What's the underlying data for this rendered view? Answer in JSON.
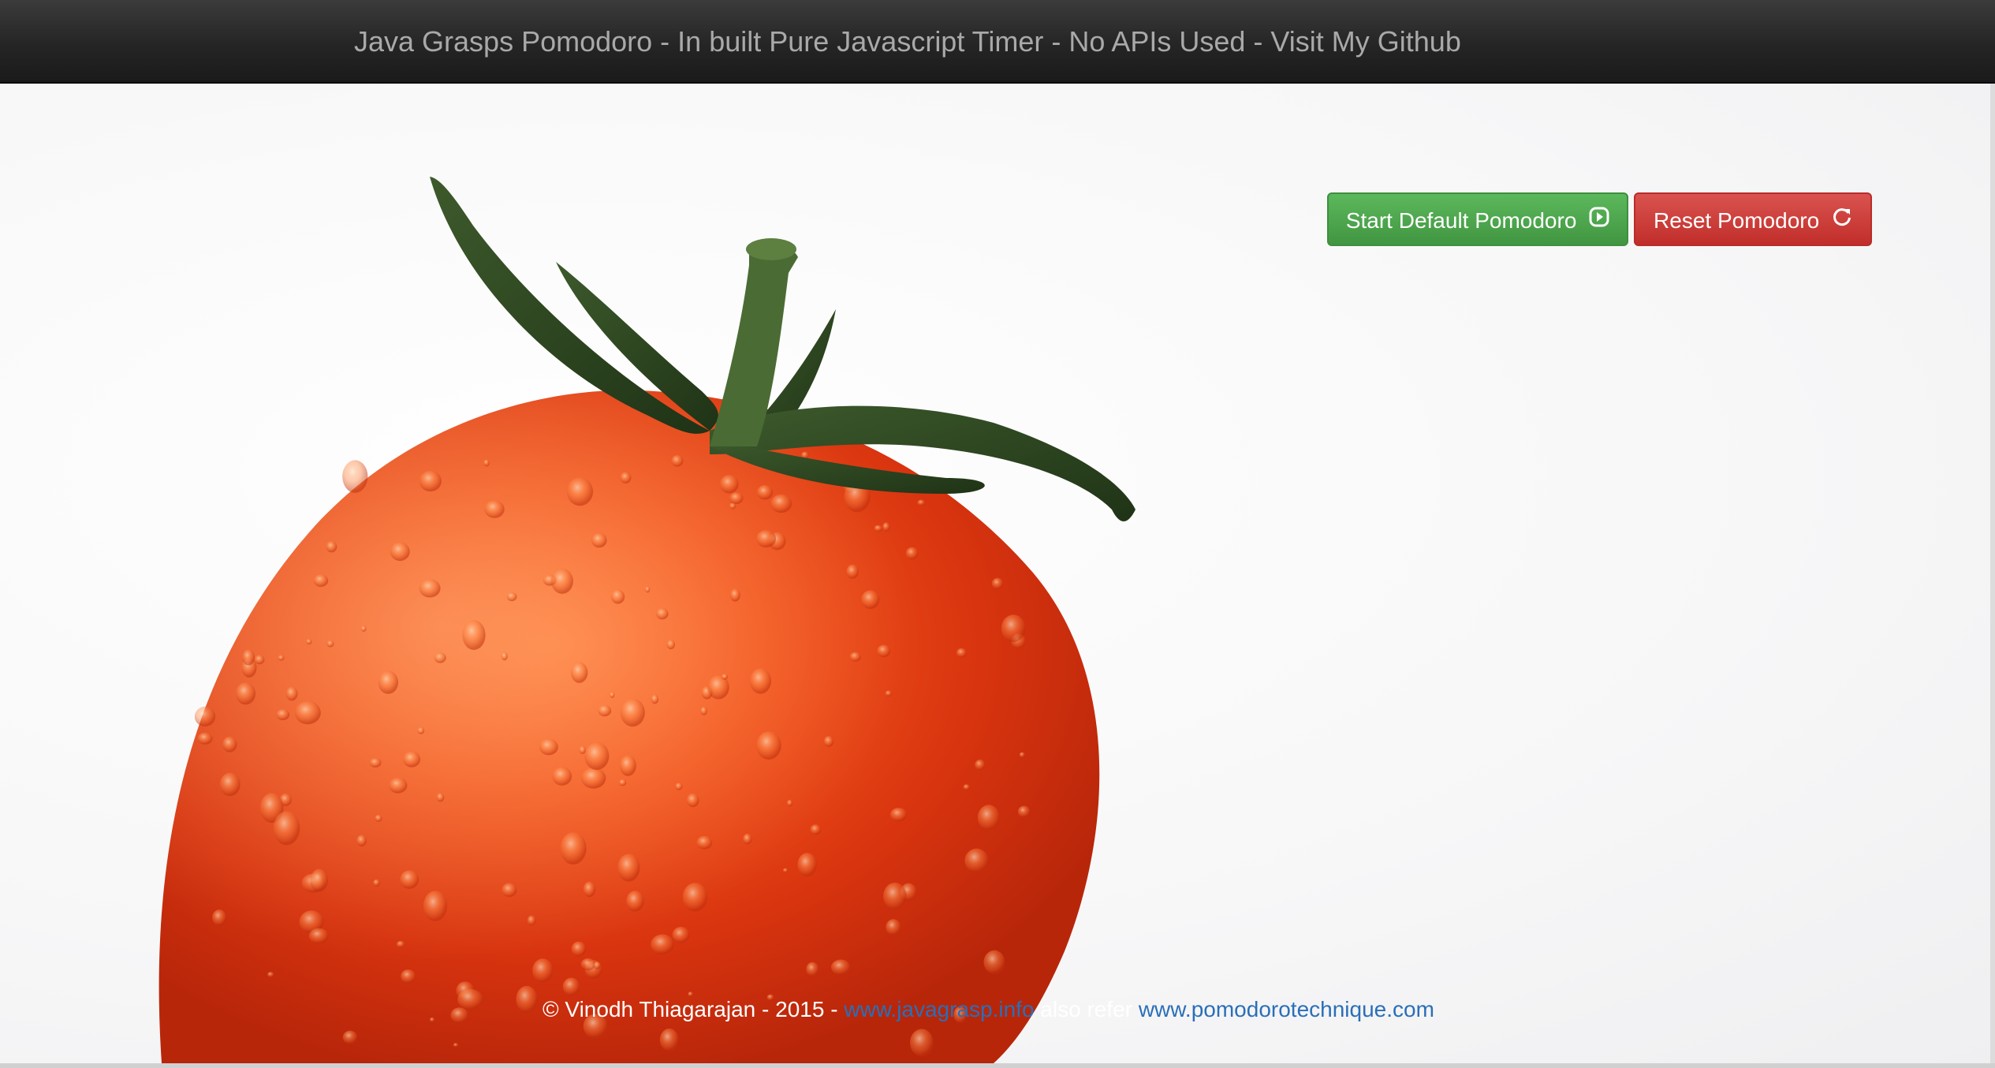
{
  "navbar": {
    "brand": "Java Grasps Pomodoro - In built Pure Javascript Timer - No APIs Used - Visit My Github"
  },
  "actions": {
    "start_label": "Start Default Pomodoro",
    "start_icon": "play-circle-icon",
    "reset_label": "Reset Pomodoro",
    "reset_icon": "refresh-icon"
  },
  "hero": {
    "image": "tomato-photo"
  },
  "footer": {
    "copyright": "© Vinodh Thiagarajan - 2015 - ",
    "link1": "www.javagrasp.info",
    "also": " also refer ",
    "link2": "www.pomodorotechnique.com"
  },
  "colors": {
    "navbar": "#222222",
    "brand_text": "#a9a9a9",
    "start_button": "#5cb85c",
    "reset_button": "#d9534f",
    "link": "#2a6fb8",
    "tomato": "#e03a12"
  }
}
